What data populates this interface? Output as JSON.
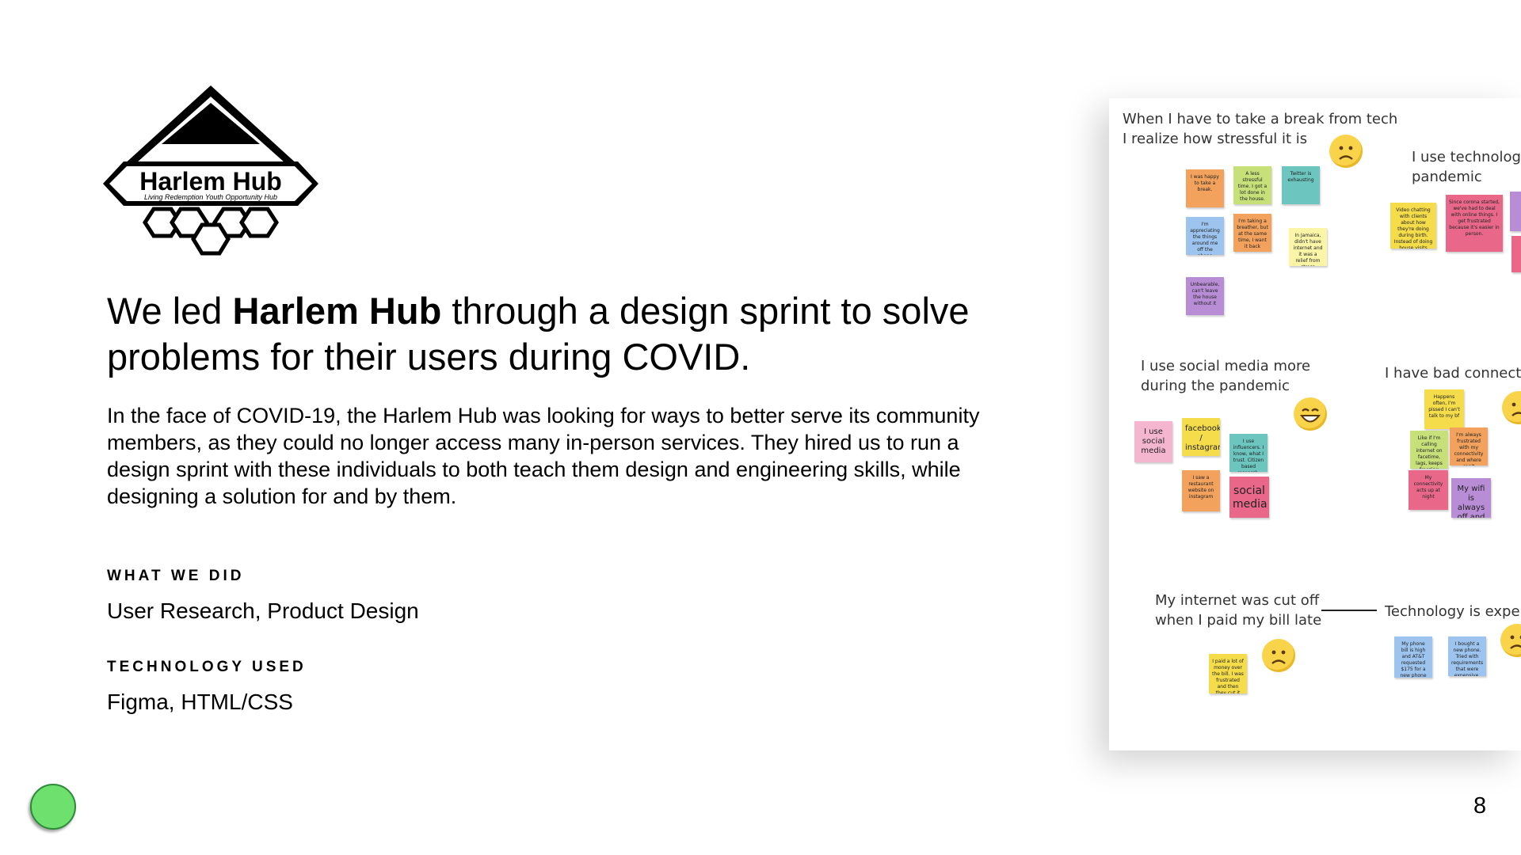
{
  "logo": {
    "name": "Harlem Hub",
    "tagline": "Living Redemption Youth Opportunity Hub"
  },
  "headline": {
    "prefix": "We led ",
    "brand": "Harlem Hub",
    "suffix": " through a design sprint to solve problems for their users during COVID."
  },
  "body": "In the face of COVID-19, the Harlem Hub was looking for ways to better serve its community members, as they could no longer access many in-person services. They hired us to run a design sprint with these individuals to both teach them design and engineering skills, while designing a solution for and by them.",
  "what_we_did": {
    "label": "WHAT WE DID",
    "value": "User Research, Product Design"
  },
  "technology_used": {
    "label": "TECHNOLOGY USED",
    "value": "Figma, HTML/CSS"
  },
  "board": {
    "clusters": [
      {
        "title_lines": [
          "When I have to take a break from tech",
          "I realize how stressful it is"
        ],
        "emoji": "sad"
      },
      {
        "title_lines": [
          "I use technology",
          "pandemic"
        ],
        "emoji": ""
      },
      {
        "title_lines": [
          "I use social media more",
          "during the pandemic"
        ],
        "emoji": "grin"
      },
      {
        "title_lines": [
          "I have bad connectiv"
        ],
        "emoji": "sad"
      },
      {
        "title_lines": [
          "My internet was cut off",
          "when I paid my bill late"
        ],
        "emoji": "sad"
      },
      {
        "title_lines": [
          "Technology is expens"
        ],
        "emoji": "sad"
      }
    ],
    "notes": {
      "n1": "I was happy to take a break.",
      "n2": "A less stressful time. I got a lot done in the house.",
      "n3": "Twitter is exhausting",
      "n4": "I'm appreciating the things around me off the phone",
      "n5": "I'm taking a breather, but at the same time, I want it back",
      "n6": "In Jamaica, didn't have internet and it was a relief from stress",
      "n7": "Unbearable, can't leave the house without it",
      "n8": "Video chatting with clients about how they're doing during birth. Instead of doing house visits",
      "n9": "Since corona started, we've had to deal with online things. I get frustrated because it's easier in person.",
      "n10": "I use social media",
      "n11": "facebook / instagram",
      "n12": "I use influencers. I know, what I trust. Citizen based research.",
      "n13": "I saw a restaurant website on instagram",
      "n14": "social media",
      "n15": "Happens often, I'm pissed I can't talk to my bf",
      "n16": "Like if I'm calling internet on facetime, lags, keeps freezing",
      "n17": "I'm always frustrated with my connectivity and where can't connect work",
      "n18": "My connectivity acts up at night",
      "n19": "My wifi is always off and on",
      "n20": "I paid a lot of money over the bill. I was frustrated and then they cut it off to get internet",
      "n21": "My phone bill is high and AT&T requested $175 for a new phone",
      "n22": "I bought a new phone. Tried with requirements that were expensive. (always used wifi)"
    }
  },
  "page_number": "8",
  "colors": {
    "orange": "#f2a25c",
    "yellow_green": "#c7e07a",
    "teal": "#6cc5bf",
    "blue": "#9cc4ee",
    "light_yellow": "#fbf5a8",
    "purple": "#b98cd6",
    "yellow": "#f5dc4a",
    "pink_red": "#e9688a",
    "pink": "#f4b6cf",
    "green_dot": "#6ee06e"
  }
}
